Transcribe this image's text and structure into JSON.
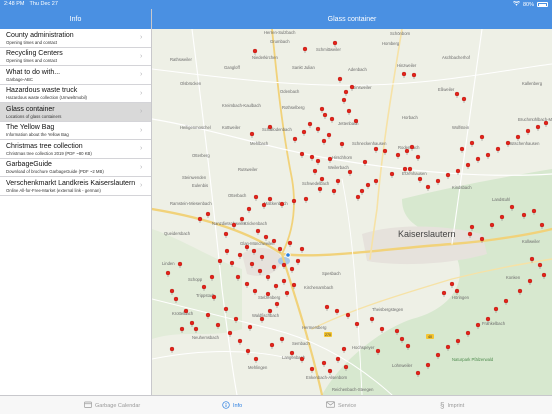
{
  "status_bar": {
    "time": "2:48 PM",
    "date": "Thu Dec 27",
    "battery": "80%"
  },
  "nav": {
    "left_title": "Info",
    "right_title": "Glass container"
  },
  "list": [
    {
      "title": "County administration",
      "subtitle": "Opening times and contact"
    },
    {
      "title": "Recycling Centers",
      "subtitle": "Opening times and contact"
    },
    {
      "title": "What to do with...",
      "subtitle": "Garbage-ABC"
    },
    {
      "title": "Hazardous waste truck",
      "subtitle": "Hazardous waste collection (Umweltmobil)"
    },
    {
      "title": "Glass container",
      "subtitle": "Locations of glass containers",
      "selected": true
    },
    {
      "title": "The Yellow Bag",
      "subtitle": "Information about the Yellow Bag"
    },
    {
      "title": "Christmas tree collection",
      "subtitle": "Christmas tree collection 2019 (PDF ~80 KB)"
    },
    {
      "title": "GarbageGuide",
      "subtitle": "Download of brochure GarbageGuide (PDF ~2 MB)"
    },
    {
      "title": "Verschenkmarkt Landkreis Kaiserslautern",
      "subtitle": "Online All-for-Free-Market (external link - german)"
    }
  ],
  "map": {
    "city_label": "Kaiserslautern",
    "place_labels": [
      "Herren-Sulzbach",
      "Schönborn",
      "Grumbach",
      "Homberg",
      "Schmittweiler",
      "Rathsweiler",
      "Niederkirchen",
      "Gangloff",
      "Sankt Julian",
      "Hinzweiler",
      "Adenbach",
      "Olsbrücken",
      "Odenbach",
      "Ginsweiler",
      "Eßweiler",
      "Kreimbach-Kaulbach",
      "Rothselberg",
      "Jettenbach",
      "Wolfstein",
      "Heiligenmoschel",
      "Schallodenbach",
      "Otterberg",
      "Mehlbach",
      "Schneckenhausen",
      "Rutsweiler",
      "Hirschhorn",
      "Erzenhausen",
      "Weilerbach",
      "Rodenbach",
      "Schwedelbach",
      "Mackenbach",
      "Eulenbis",
      "Otterbach",
      "Ramstein-Miesenbach",
      "Kindsbach",
      "Landstuhl",
      "Hütschenhausen",
      "Bruchmühlbach-Miesau",
      "Queidersbach",
      "Krickenbach",
      "Linden",
      "Schopp",
      "Trippstadt",
      "Stelzenberg",
      "Kirchenarnbach",
      "Waldfischbach",
      "Hermersberg",
      "Hochspeyer",
      "Enkenbach-Alsenborn",
      "Mehlingen",
      "Sembach",
      "Neuhemsbach",
      "Höringen",
      "Kollweiler",
      "Konken",
      "Nanzdietschweiler",
      "Glan-Münchweiler",
      "Steinwenden",
      "Kottweiler",
      "Spesbach",
      "Theisbergstegen",
      "Krottelbach",
      "Langenbach",
      "Reichenbach-Steegen",
      "Lohnweiler",
      "Frankelbach",
      "Horbach",
      "Kallenberg",
      "Aschbacherhof"
    ],
    "park_label": "Naturpark Pfälzerwald",
    "road_shields": [
      "270",
      "40",
      "48",
      "37"
    ]
  },
  "tabs": [
    {
      "label": "Garbage Calendar",
      "icon": "calendar-icon",
      "active": false
    },
    {
      "label": "Info",
      "icon": "info-icon",
      "active": true
    },
    {
      "label": "Service",
      "icon": "mail-icon",
      "active": false
    },
    {
      "label": "Imprint",
      "icon": "paragraph-icon",
      "active": false
    }
  ],
  "colors": {
    "accent": "#4a90e2",
    "active_tab": "#2b7fe0",
    "pin": "#e2231a"
  }
}
